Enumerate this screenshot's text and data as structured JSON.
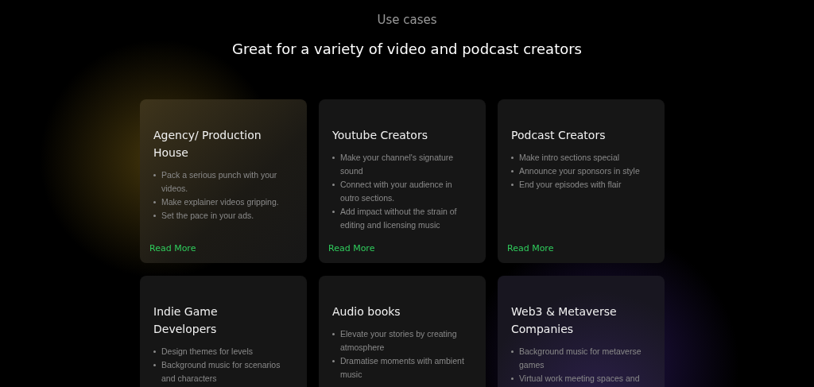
{
  "section_label": "Use cases",
  "heading": "Great for a variety of video and podcast creators",
  "cards": [
    {
      "title": "Agency/ Production House",
      "points": [
        "Pack a serious punch with your videos.",
        "Make explainer videos gripping.",
        "Set the pace in your ads."
      ],
      "link": "Read More"
    },
    {
      "title": "Youtube Creators",
      "points": [
        "Make your channel's signature sound",
        "Connect with your audience in outro sections.",
        "Add impact without the strain of editing and licensing music"
      ],
      "link": "Read More"
    },
    {
      "title": "Podcast Creators",
      "points": [
        "Make intro sections special",
        "Announce your sponsors in style",
        "End your episodes with flair"
      ],
      "link": "Read More"
    },
    {
      "title": "Indie Game Developers",
      "points": [
        "Design themes for levels",
        "Background music for scenarios and characters"
      ]
    },
    {
      "title": "Audio books",
      "points": [
        "Elevate your stories by creating atmosphere",
        "Dramatise moments with ambient music"
      ]
    },
    {
      "title": "Web3 & Metaverse Companies",
      "points": [
        "Background music for metaverse games",
        "Virtual work meeting spaces and"
      ]
    }
  ]
}
